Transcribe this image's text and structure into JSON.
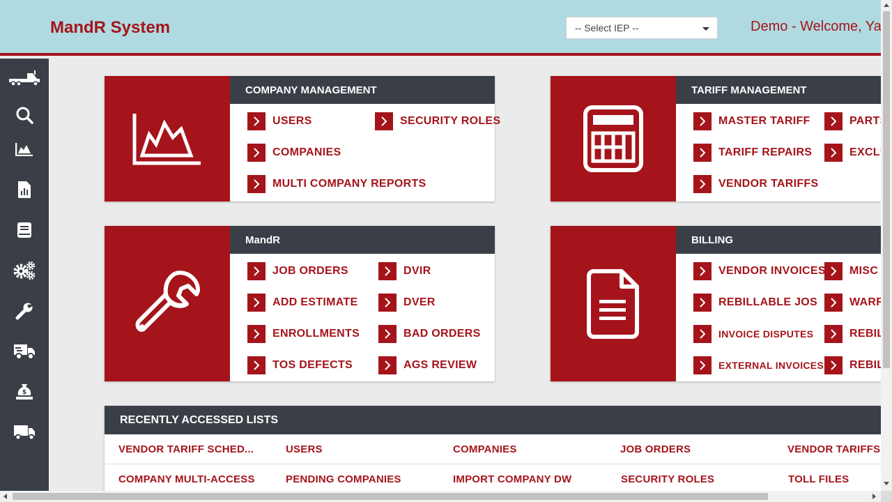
{
  "header": {
    "title": "MandR System",
    "iep_select": "-- Select IEP --",
    "welcome": "Demo - Welcome, Ya"
  },
  "sidebar": {
    "items": [
      {
        "icon": "truck-icon"
      },
      {
        "icon": "search-icon"
      },
      {
        "icon": "area-chart-icon"
      },
      {
        "icon": "report-file-icon"
      },
      {
        "icon": "book-icon"
      },
      {
        "icon": "gears-icon"
      },
      {
        "icon": "wrench-icon"
      },
      {
        "icon": "delivery-truck-icon"
      },
      {
        "icon": "money-bag-icon"
      },
      {
        "icon": "box-truck-icon"
      }
    ]
  },
  "cards": {
    "company": {
      "title": "COMPANY MANAGEMENT",
      "icon": "area-chart-icon",
      "links": [
        "USERS",
        "SECURITY ROLES",
        "COMPANIES",
        "MULTI COMPANY REPORTS"
      ]
    },
    "tariff": {
      "title": "TARIFF MANAGEMENT",
      "icon": "calculator-icon",
      "links": [
        "MASTER TARIFF",
        "PARTS",
        "TARIFF REPAIRS",
        "EXCLU",
        "VENDOR TARIFFS"
      ]
    },
    "mandr": {
      "title": "MandR",
      "icon": "wrench-icon",
      "links": [
        "JOB ORDERS",
        "DVIR",
        "ADD ESTIMATE",
        "DVER",
        "ENROLLMENTS",
        "BAD ORDERS",
        "TOS DEFECTS",
        "AGS REVIEW"
      ]
    },
    "billing": {
      "title": "BILLING",
      "icon": "document-icon",
      "links": [
        "VENDOR INVOICES",
        "MISC I",
        "REBILLABLE JOS",
        "WARR",
        "INVOICE DISPUTES",
        "REBIL",
        "EXTERNAL INVOICES",
        "REBIL"
      ]
    }
  },
  "recent": {
    "title": "RECENTLY ACCESSED LISTS",
    "rows": [
      [
        "VENDOR TARIFF SCHED...",
        "USERS",
        "COMPANIES",
        "JOB ORDERS",
        "VENDOR TARIFFS"
      ],
      [
        "COMPANY MULTI-ACCESS",
        "PENDING COMPANIES",
        "IMPORT COMPANY DW",
        "SECURITY ROLES",
        "TOLL FILES"
      ]
    ]
  },
  "colors": {
    "brand_red": "#a5141b",
    "header_bg": "#b0dae1",
    "dark": "#3a3f47"
  }
}
